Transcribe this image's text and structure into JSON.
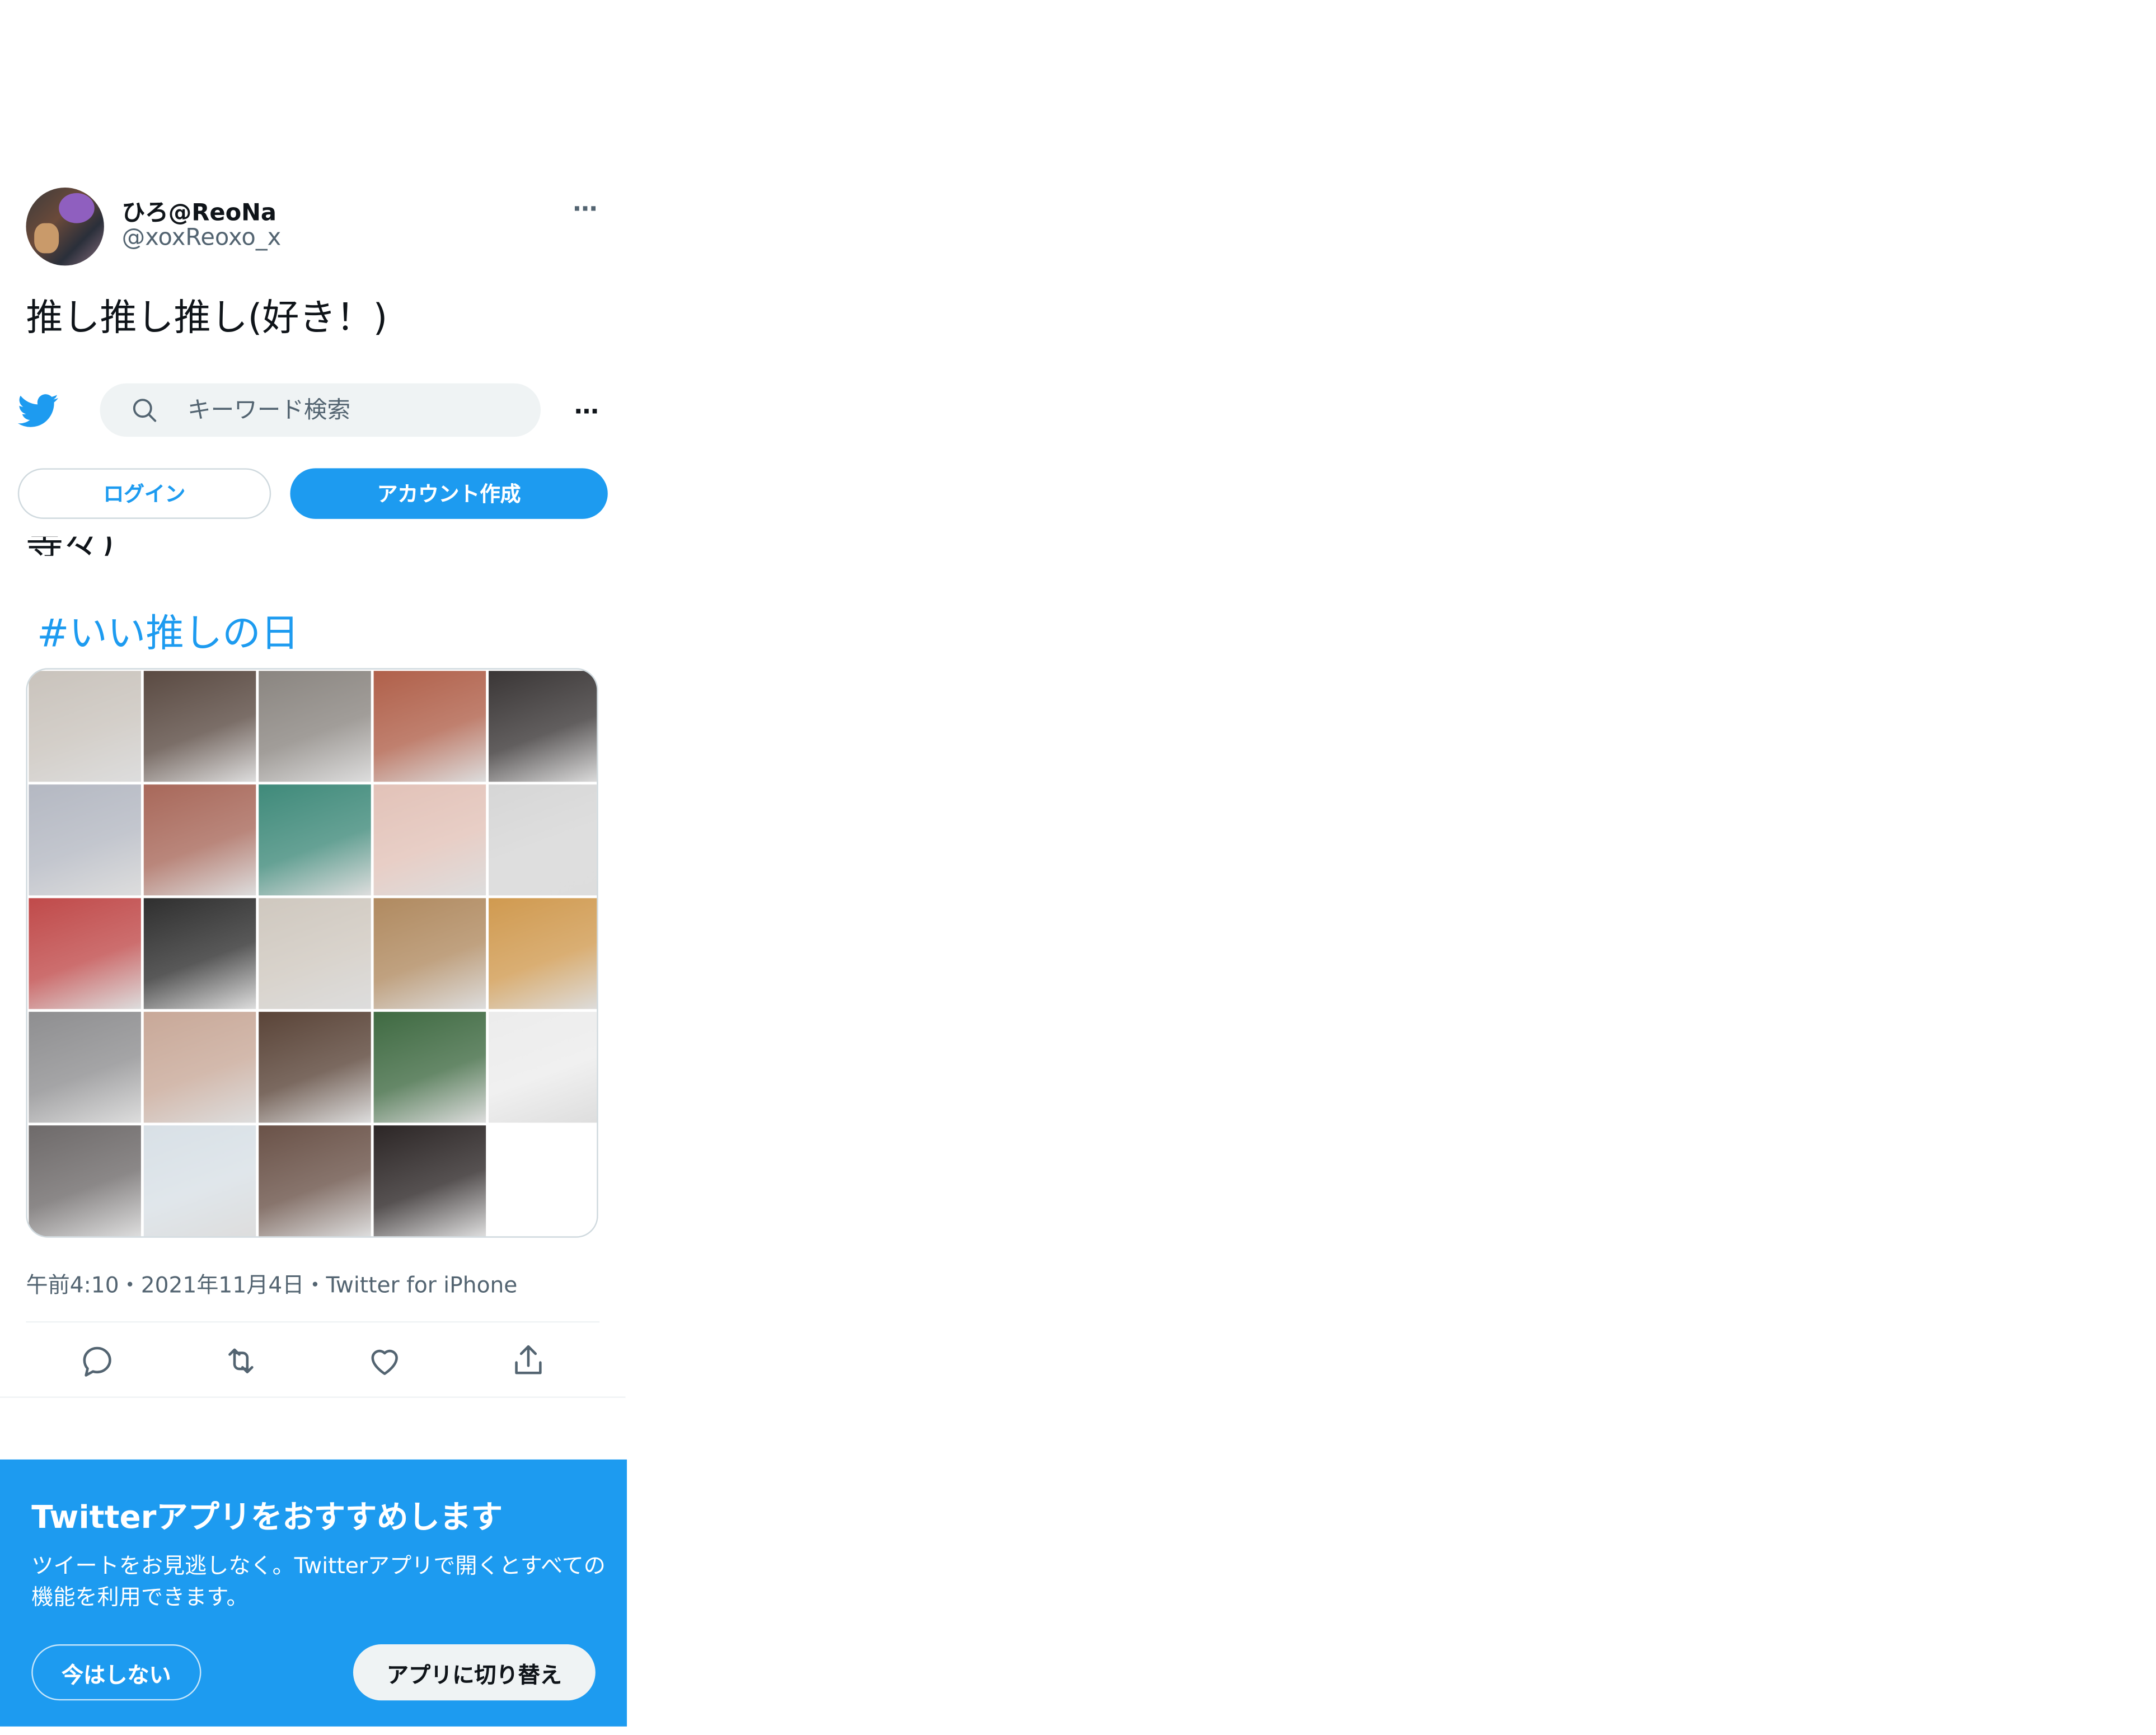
{
  "tweet": {
    "display_name": "ひろ@ReoNa",
    "handle": "@xoxReoxo_x",
    "text": "推し推し推し(好き！)",
    "partial_text": "等々)",
    "hashtag": "#いい推しの日",
    "meta": "午前4:10・2021年11月4日・Twitter for iPhone",
    "more_icon": "…"
  },
  "images": [
    {
      "color": "#c9c3bc",
      "icon": "photo"
    },
    {
      "color": "#5a4a42",
      "icon": "photo"
    },
    {
      "color": "#8a8580",
      "icon": "photo"
    },
    {
      "color": "#b0604a",
      "icon": "photo"
    },
    {
      "color": "#3a3636",
      "icon": "photo"
    },
    {
      "color": "#b4b8c2",
      "icon": "photo"
    },
    {
      "color": "#a8685a",
      "icon": "photo"
    },
    {
      "color": "#3f8a7a",
      "icon": "photo"
    },
    {
      "color": "#e2c2b8",
      "icon": "photo"
    },
    {
      "color": "#d6d6d6",
      "icon": "photo"
    },
    {
      "color": "#c04a4a",
      "icon": "photo"
    },
    {
      "color": "#2f2f2f",
      "icon": "photo"
    },
    {
      "color": "#cfc8bf",
      "icon": "photo"
    },
    {
      "color": "#b08a60",
      "icon": "photo"
    },
    {
      "color": "#d09a50",
      "icon": "photo"
    },
    {
      "color": "#8e8e90",
      "icon": "photo"
    },
    {
      "color": "#c8a898",
      "icon": "photo"
    },
    {
      "color": "#5a4438",
      "icon": "photo"
    },
    {
      "color": "#3f6a42",
      "icon": "photo"
    },
    {
      "color": "#ececec",
      "icon": "photo"
    },
    {
      "color": "#6e6a6a",
      "icon": "photo"
    },
    {
      "color": "#d8e0e6",
      "icon": "photo"
    },
    {
      "color": "#6a5248",
      "icon": "photo"
    },
    {
      "color": "#2c2626",
      "icon": "photo"
    }
  ],
  "actions": [
    {
      "name": "reply-icon"
    },
    {
      "name": "retweet-icon"
    },
    {
      "name": "like-icon"
    },
    {
      "name": "share-icon"
    }
  ],
  "header": {
    "logo": "twitter-bird-icon",
    "search_placeholder": "キーワード検索",
    "more_icon": "…",
    "login_label": "ログイン",
    "signup_label": "アカウント作成"
  },
  "banner": {
    "title": "Twitterアプリをおすすめします",
    "body": "ツイートをお見逃しなく。Twitterアプリで開くとすべての機能を利用できます。",
    "not_now_label": "今はしない",
    "switch_label": "アプリに切り替え"
  },
  "colors": {
    "accent": "#1d9bf0",
    "text": "#0f1419",
    "secondary": "#536471",
    "border": "#cfd9de"
  }
}
